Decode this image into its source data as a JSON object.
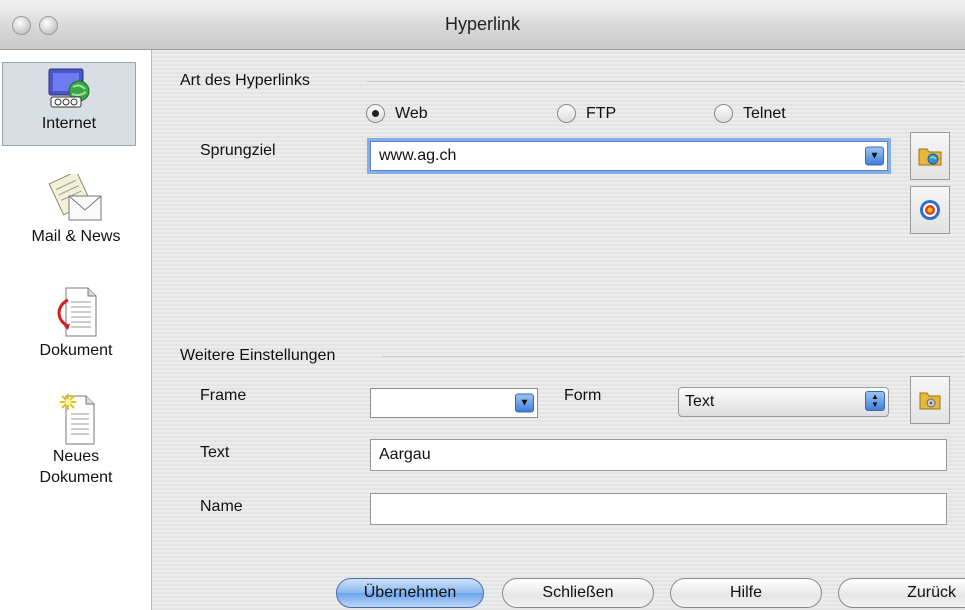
{
  "window": {
    "title": "Hyperlink"
  },
  "sidebar": {
    "items": [
      {
        "label": "Internet",
        "icon": "internet-globe-icon"
      },
      {
        "label": "Mail & News",
        "icon": "mail-envelope-icon"
      },
      {
        "label": "Dokument",
        "icon": "document-target-icon"
      },
      {
        "label": "Neues",
        "label2": "Dokument",
        "icon": "new-document-icon"
      }
    ]
  },
  "hyperlink_type": {
    "section_title": "Art des Hyperlinks",
    "options": [
      {
        "label": "Web",
        "selected": true
      },
      {
        "label": "FTP",
        "selected": false
      },
      {
        "label": "Telnet",
        "selected": false
      }
    ],
    "target_label": "Sprungziel",
    "target_value": "www.ag.ch"
  },
  "further_settings": {
    "section_title": "Weitere Einstellungen",
    "frame_label": "Frame",
    "frame_value": "",
    "form_label": "Form",
    "form_value": "Text",
    "text_label": "Text",
    "text_value": "Aargau",
    "name_label": "Name",
    "name_value": ""
  },
  "buttons": {
    "apply": "Übernehmen",
    "close": "Schließen",
    "help": "Hilfe",
    "back": "Zurück"
  },
  "colors": {
    "focus_ring": "#86aee6",
    "accent_blue": "#3f7fd8"
  }
}
